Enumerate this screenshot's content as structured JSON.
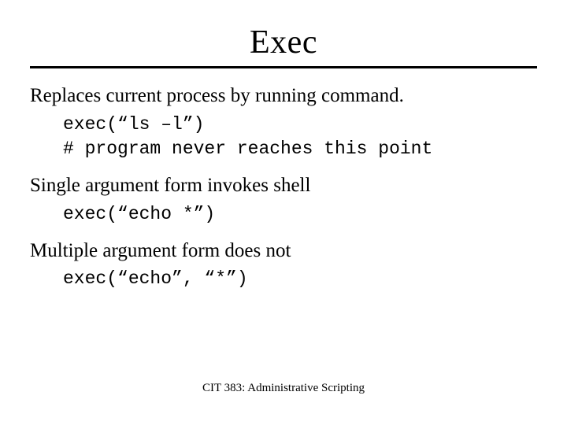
{
  "slide": {
    "title": "Exec",
    "line1": "Replaces current process by running command.",
    "code1": "exec(“ls –l”)\n# program never reaches this point",
    "line2": "Single argument form invokes shell",
    "code2": "exec(“echo *”)",
    "line3": "Multiple argument form does not",
    "code3": "exec(“echo”, “*”)",
    "footer": "CIT 383: Administrative Scripting"
  }
}
